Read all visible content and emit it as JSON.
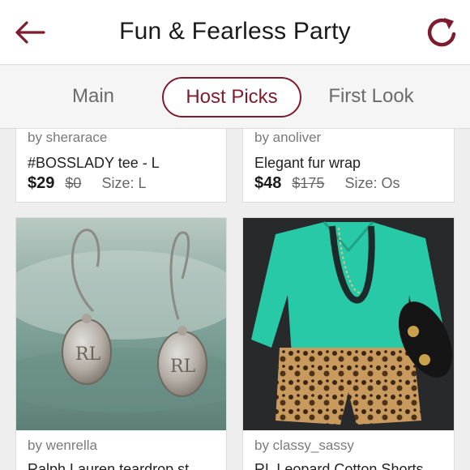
{
  "header": {
    "title": "Fun & Fearless Party",
    "back_icon": "back-arrow-icon",
    "refresh_icon": "refresh-icon",
    "accent": "#7d1c2e"
  },
  "tabs": [
    {
      "label": "Main"
    },
    {
      "label": "Host Picks"
    },
    {
      "label": "First Look"
    }
  ],
  "listings": [
    {
      "by": "by sherarace",
      "title": "#BOSSLADY tee - L",
      "price": "$29",
      "original": "$0",
      "size": "Size: L"
    },
    {
      "by": "by anoliver",
      "title": "Elegant fur wrap",
      "price": "$48",
      "original": "$175",
      "size": "Size: Os"
    },
    {
      "by": "by wenrella",
      "title": "Ralph Lauren teardrop st"
    },
    {
      "by": "by classy_sassy",
      "title": "RL Leopard Cotton Shorts"
    }
  ]
}
